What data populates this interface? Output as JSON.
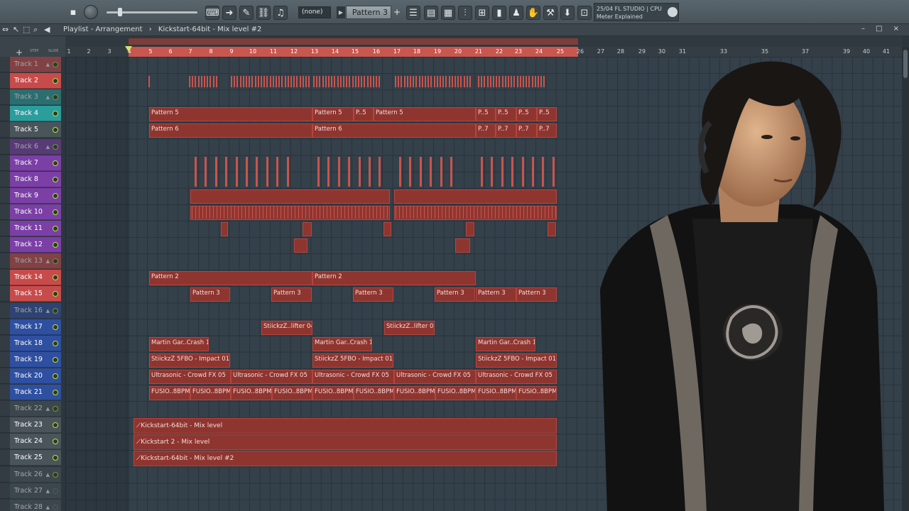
{
  "toolbar": {
    "pattern_select_none": "(none)",
    "pattern_name": "Pattern 3",
    "pattern_plus": "+",
    "hint_line1": "25/04  FL STUDIO | CPU",
    "hint_line2": "Meter Explained"
  },
  "playlist": {
    "title": "Playlist - Arrangement",
    "sep": "›",
    "arrangement": "Kickstart-64bit - Mix level #2",
    "window_controls": "– □ ×",
    "ruler_ticks": [
      "1",
      "2",
      "3",
      "4",
      "5",
      "6",
      "7",
      "8",
      "9",
      "10",
      "11",
      "12",
      "13",
      "14",
      "15",
      "16",
      "17",
      "18",
      "19",
      "20",
      "21",
      "22",
      "23",
      "24",
      "25",
      "26",
      "27",
      "28",
      "29",
      "30",
      "31",
      "33",
      "35",
      "37",
      "39",
      "40",
      "41"
    ],
    "step_label": "STEP",
    "slide_label": "SLIDE"
  },
  "tracks": [
    {
      "label": "Track 1",
      "group": true
    },
    {
      "label": "Track 2"
    },
    {
      "label": "Track 3",
      "group": true
    },
    {
      "label": "Track 4"
    },
    {
      "label": "Track 5"
    },
    {
      "label": "Track 6",
      "group": true
    },
    {
      "label": "Track 7"
    },
    {
      "label": "Track 8"
    },
    {
      "label": "Track 9"
    },
    {
      "label": "Track 10"
    },
    {
      "label": "Track 11"
    },
    {
      "label": "Track 12"
    },
    {
      "label": "Track 13",
      "group": true
    },
    {
      "label": "Track 14"
    },
    {
      "label": "Track 15"
    },
    {
      "label": "Track 16",
      "group": true
    },
    {
      "label": "Track 17"
    },
    {
      "label": "Track 18"
    },
    {
      "label": "Track 19"
    },
    {
      "label": "Track 20"
    },
    {
      "label": "Track 21"
    },
    {
      "label": "Track 22",
      "group": true
    },
    {
      "label": "Track 23"
    },
    {
      "label": "Track 24"
    },
    {
      "label": "Track 25"
    },
    {
      "label": "Track 26",
      "group": true
    },
    {
      "label": "Track 27",
      "group": true
    },
    {
      "label": "Track 28",
      "group": true
    }
  ],
  "clips": {
    "pattern5": "Pattern 5",
    "p5_short": "P..5",
    "pattern6": "Pattern 6",
    "p7_short": "P..7",
    "pattern2": "Pattern 2",
    "pattern3": "Pattern 3",
    "lifter": "StiickzZ..lifter 04",
    "crash": "Martin Gar..Crash 1_2",
    "impact": "StiickzZ 5FBO - Impact 01_2",
    "crowd": "Ultrasonic - Crowd FX 05",
    "fusio": "FUSIO..8BPM",
    "auto1": "Kickstart-64bit - Mix level",
    "auto2": "Kickstart 2 - Mix level",
    "auto3": "Kickstart-64bit - Mix level #2"
  },
  "colors": {
    "clip": "#8f3530",
    "clip_border": "#b4453e",
    "accent_green": "#b4e34f"
  }
}
